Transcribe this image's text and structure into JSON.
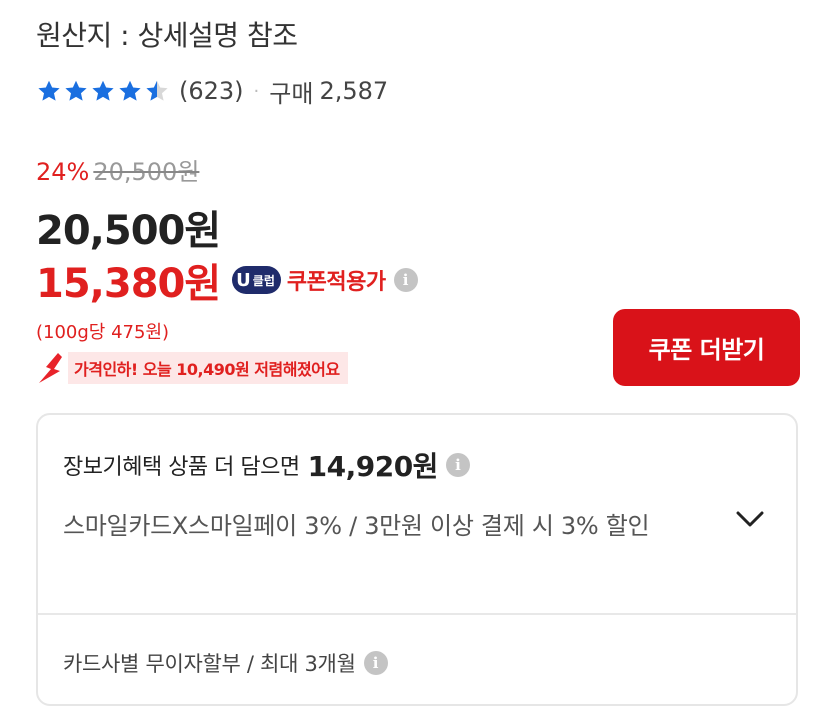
{
  "product": {
    "origin": "원산지 : 상세설명 참조",
    "rating": 4.5,
    "review_count": "(623)",
    "separator": "·",
    "purchase_label": "구매",
    "purchase_count": "2,587"
  },
  "pricing": {
    "discount_rate": "24%",
    "original_price": "20,500원",
    "sale_price": "20,500원",
    "coupon_price": "15,380원",
    "badge_u": "U",
    "badge_text": "클럽",
    "coupon_label": "쿠폰적용가",
    "per_unit": "(100g당 475원)",
    "price_drop_text": "가격인하! 오늘 10,490원 저렴해졌어요",
    "more_coupon_button": "쿠폰 더받기"
  },
  "benefit": {
    "head_text": "장보기혜택 상품 더 담으면",
    "head_price": "14,920원",
    "description": "스마일카드X스마일페이 3% / 3만원 이상 결제 시 3% 할인",
    "installment": "카드사별 무이자할부 / 최대 3개월"
  },
  "colors": {
    "accent_red": "#e0201f",
    "button_red": "#d91219",
    "star_blue": "#1a6fe0",
    "badge_navy": "#1f2b6b"
  },
  "icons": {
    "star": "star-icon",
    "info": "info-icon",
    "chevron": "chevron-down-icon",
    "down_arrow": "down-arrow-icon"
  }
}
